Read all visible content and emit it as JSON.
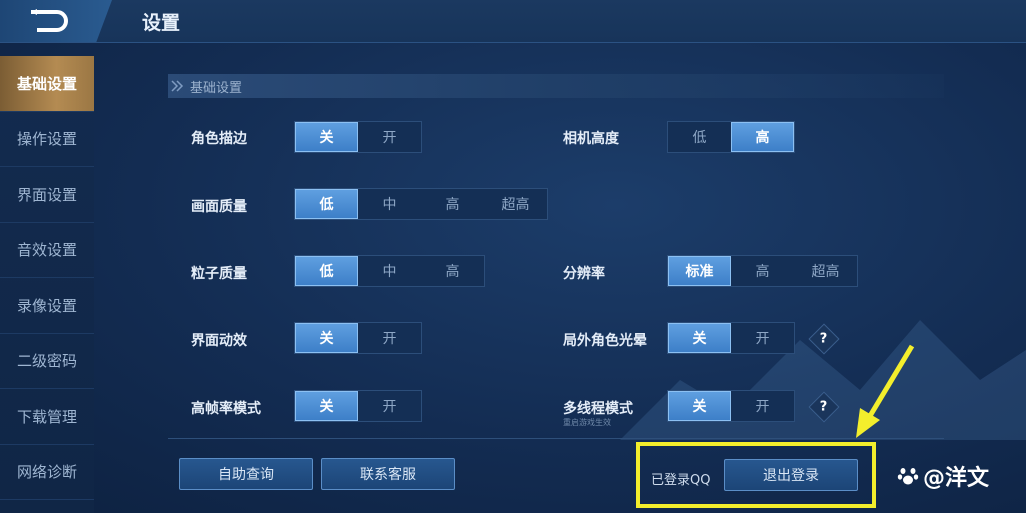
{
  "header": {
    "title": "设置"
  },
  "sidebar": {
    "items": [
      {
        "label": "基础设置",
        "active": true
      },
      {
        "label": "操作设置",
        "active": false
      },
      {
        "label": "界面设置",
        "active": false
      },
      {
        "label": "音效设置",
        "active": false
      },
      {
        "label": "录像设置",
        "active": false
      },
      {
        "label": "二级密码",
        "active": false
      },
      {
        "label": "下载管理",
        "active": false
      },
      {
        "label": "网络诊断",
        "active": false
      }
    ]
  },
  "section": {
    "title": "基础设置"
  },
  "settings": {
    "role_outline": {
      "label": "角色描边",
      "options": [
        "关",
        "开"
      ],
      "selected": "关"
    },
    "camera_height": {
      "label": "相机高度",
      "options": [
        "低",
        "高"
      ],
      "selected": "高"
    },
    "graphics_quality": {
      "label": "画面质量",
      "options": [
        "低",
        "中",
        "高",
        "超高"
      ],
      "selected": "低"
    },
    "particle_quality": {
      "label": "粒子质量",
      "options": [
        "低",
        "中",
        "高"
      ],
      "selected": "低"
    },
    "resolution": {
      "label": "分辨率",
      "options": [
        "标准",
        "高",
        "超高"
      ],
      "selected": "标准"
    },
    "ui_effects": {
      "label": "界面动效",
      "options": [
        "关",
        "开"
      ],
      "selected": "关"
    },
    "outside_halo": {
      "label": "局外角色光晕",
      "options": [
        "关",
        "开"
      ],
      "selected": "关"
    },
    "high_fps": {
      "label": "高帧率模式",
      "options": [
        "关",
        "开"
      ],
      "selected": "关"
    },
    "multithread": {
      "label": "多线程模式",
      "options": [
        "关",
        "开"
      ],
      "selected": "关",
      "note": "重启游戏生效"
    }
  },
  "help": {
    "symbol": "?"
  },
  "footer": {
    "self_help_label": "自助查询",
    "contact_label": "联系客服",
    "logged_in_label": "已登录QQ",
    "logout_label": "退出登录"
  },
  "watermark": {
    "text": "@洋文"
  },
  "colors": {
    "highlight": "#f3ee2c",
    "selected": "#4a8bd2",
    "active_tab": "#b48b52"
  }
}
